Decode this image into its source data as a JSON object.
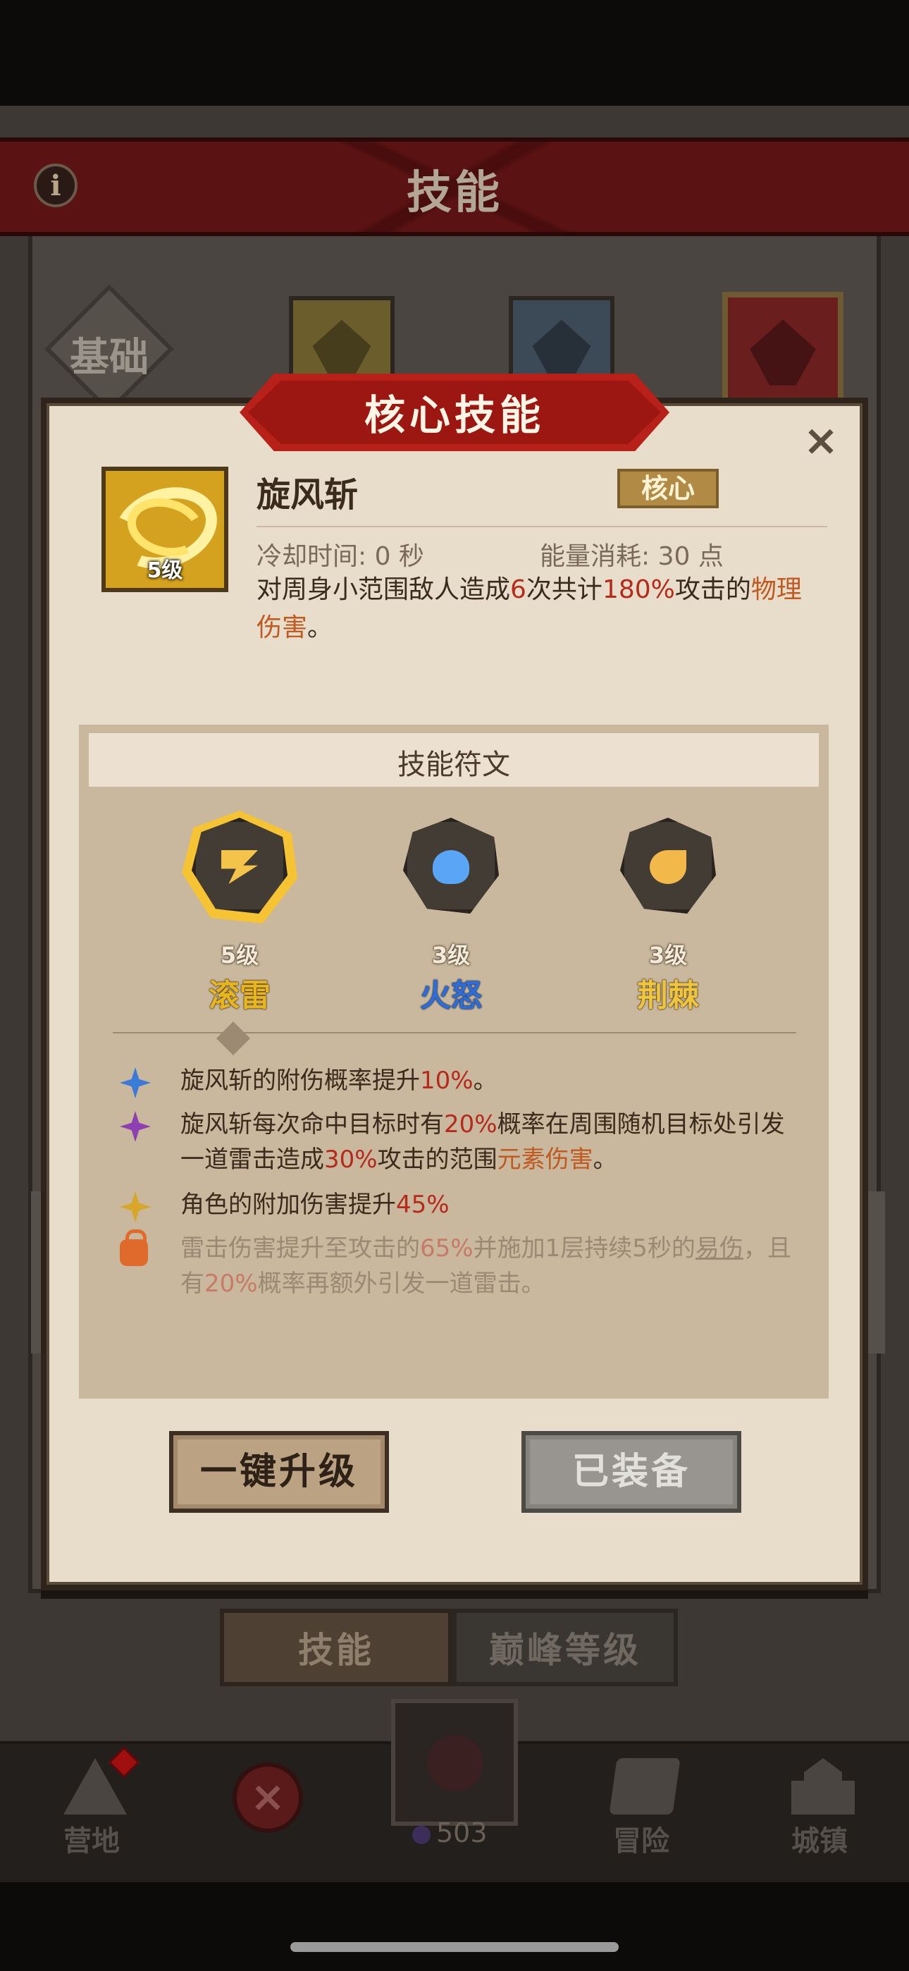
{
  "header": {
    "title": "技能",
    "info_icon": "i"
  },
  "category": {
    "label": "基础"
  },
  "modal": {
    "title": "核心技能",
    "close_icon": "×",
    "skill": {
      "name": "旋风斩",
      "level": "5级",
      "tag": "核心",
      "cooldown": "冷却时间: 0 秒",
      "energy": "能量消耗: 30 点",
      "desc_parts": [
        "对周身小范围敌人造成",
        "6",
        "次共计",
        "180%",
        "攻击的",
        "物理伤害",
        "。"
      ]
    },
    "runes": {
      "title": "技能符文",
      "items": [
        {
          "level": "5级",
          "name": "滚雷",
          "icon": "bolt-icon"
        },
        {
          "level": "3级",
          "name": "火怒",
          "icon": "fire-icon"
        },
        {
          "level": "3级",
          "name": "荆棘",
          "icon": "thorn-icon"
        }
      ]
    },
    "effects": [
      {
        "parts": [
          "旋风斩的附伤概率提升",
          "10%",
          "。"
        ]
      },
      {
        "parts": [
          "旋风斩每次命中目标时有",
          "20%",
          "概率在周围随机目标处引发",
          "一道雷击造成",
          "30%",
          "攻击的范围",
          "元素伤害",
          "。"
        ]
      },
      {
        "parts": [
          "角色的附加伤害提升",
          "45%"
        ]
      },
      {
        "parts": [
          "雷击伤害提升至攻击的",
          "65%",
          "并施加1层持续5秒的",
          "易伤",
          "，且",
          "有",
          "20%",
          "概率再额外引发一道雷击。"
        ]
      }
    ],
    "buttons": {
      "upgrade": "一键升级",
      "equipped": "已装备"
    }
  },
  "bottom_tabs": {
    "skills": "技能",
    "peak": "巅峰等级"
  },
  "nav": {
    "camp": "营地",
    "close": "×",
    "count": "503",
    "adventure": "冒险",
    "town": "城镇"
  },
  "colors": {
    "accent_red": "#b62a1c",
    "element_orange": "#c05a20",
    "modal_bg": "#e8dccb"
  }
}
